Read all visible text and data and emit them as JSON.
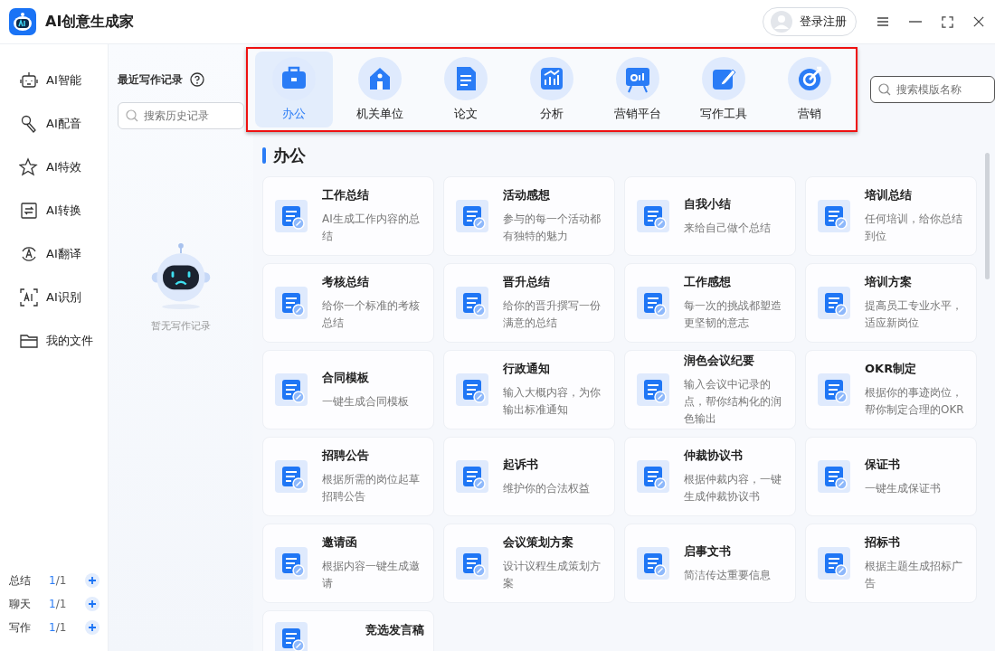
{
  "app": {
    "title": "AI创意生成家",
    "login": "登录注册"
  },
  "sidebar": {
    "items": [
      {
        "label": "AI智能"
      },
      {
        "label": "AI配音"
      },
      {
        "label": "AI特效"
      },
      {
        "label": "AI转换"
      },
      {
        "label": "AI翻译"
      },
      {
        "label": "AI识别"
      },
      {
        "label": "我的文件"
      }
    ],
    "quotas": [
      {
        "label": "总结",
        "used": "1",
        "total": "/1"
      },
      {
        "label": "聊天",
        "used": "1",
        "total": "/1"
      },
      {
        "label": "写作",
        "used": "1",
        "total": "/1"
      }
    ]
  },
  "history": {
    "title": "最近写作记录",
    "search": {
      "placeholder": "搜索历史记录"
    },
    "empty": "暂无写作记录"
  },
  "categories": [
    {
      "label": "办公",
      "selected": true
    },
    {
      "label": "机关单位",
      "selected": false
    },
    {
      "label": "论文",
      "selected": false
    },
    {
      "label": "分析",
      "selected": false
    },
    {
      "label": "营销平台",
      "selected": false
    },
    {
      "label": "写作工具",
      "selected": false
    },
    {
      "label": "营销",
      "selected": false
    }
  ],
  "template_search": {
    "placeholder": "搜索模版名称"
  },
  "section": {
    "title": "办公"
  },
  "cards": [
    {
      "title": "工作总结",
      "desc": "AI生成工作内容的总结"
    },
    {
      "title": "活动感想",
      "desc": "参与的每一个活动都有独特的魅力"
    },
    {
      "title": "自我小结",
      "desc": "来给自己做个总结"
    },
    {
      "title": "培训总结",
      "desc": "任何培训，给你总结到位"
    },
    {
      "title": "考核总结",
      "desc": "给你一个标准的考核总结"
    },
    {
      "title": "晋升总结",
      "desc": "给你的晋升撰写一份满意的总结"
    },
    {
      "title": "工作感想",
      "desc": "每一次的挑战都塑造更坚韧的意志"
    },
    {
      "title": "培训方案",
      "desc": "提高员工专业水平，适应新岗位"
    },
    {
      "title": "合同模板",
      "desc": "一键生成合同模板"
    },
    {
      "title": "行政通知",
      "desc": "输入大概内容，为你输出标准通知"
    },
    {
      "title": "润色会议纪要",
      "desc": "输入会议中记录的点，帮你结构化的润色输出"
    },
    {
      "title": "OKR制定",
      "desc": "根据你的事迹岗位，帮你制定合理的OKR"
    },
    {
      "title": "招聘公告",
      "desc": "根据所需的岗位起草招聘公告"
    },
    {
      "title": "起诉书",
      "desc": "维护你的合法权益"
    },
    {
      "title": "仲裁协议书",
      "desc": "根据仲裁内容，一键生成仲裁协议书"
    },
    {
      "title": "保证书",
      "desc": "一键生成保证书"
    },
    {
      "title": "邀请函",
      "desc": "根据内容一键生成邀请"
    },
    {
      "title": "会议策划方案",
      "desc": "设计议程生成策划方案"
    },
    {
      "title": "启事文书",
      "desc": "简洁传达重要信息"
    },
    {
      "title": "招标书",
      "desc": "根据主题生成招标广告"
    },
    {
      "title": "竞选发言稿"
    }
  ]
}
